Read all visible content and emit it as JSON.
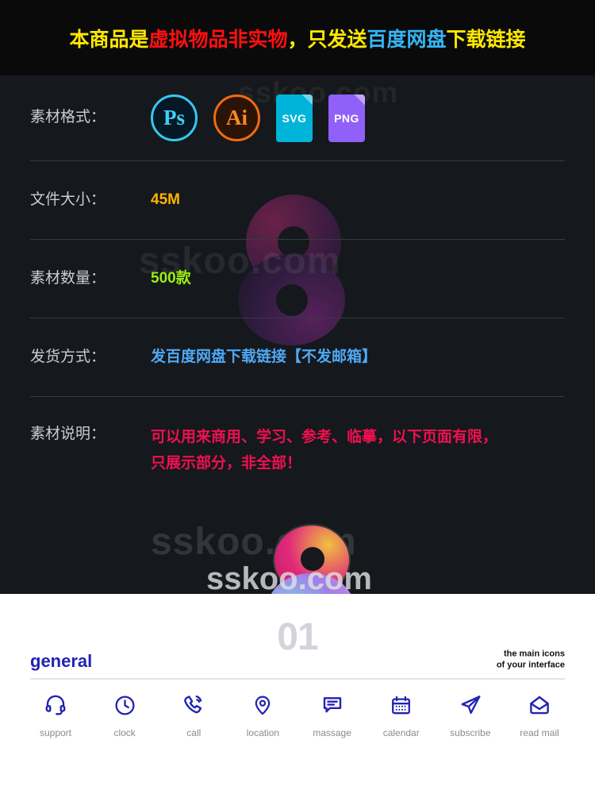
{
  "banner": {
    "segments": [
      {
        "text": "本商品是",
        "color": "#FFE800"
      },
      {
        "text": "虚拟物品非实物",
        "color": "#FF1010"
      },
      {
        "text": "，只发送",
        "color": "#FFE800"
      },
      {
        "text": "百度网盘",
        "color": "#35B5F5"
      },
      {
        "text": "下载链接",
        "color": "#FFE800"
      }
    ],
    "full_text": "本商品是虚拟物品非实物，只发送百度网盘下载链接"
  },
  "watermarks": {
    "top": "sskoo.com",
    "middle": "sskoo.com",
    "lower": "sskoo.com",
    "bottom": "sskoo.com"
  },
  "info": {
    "format": {
      "label": "素材格式：",
      "icons": [
        {
          "name": "photoshop-icon",
          "text": "Ps",
          "color": "#3FD2F5"
        },
        {
          "name": "illustrator-icon",
          "text": "Ai",
          "color": "#FF8A1E"
        },
        {
          "name": "svg-file-icon",
          "text": "SVG",
          "color": "#00B3D9"
        },
        {
          "name": "png-file-icon",
          "text": "PNG",
          "color": "#9060F8"
        }
      ]
    },
    "filesize": {
      "label": "文件大小：",
      "value": "45M",
      "color": "#FFB400"
    },
    "quantity": {
      "label": "素材数量：",
      "value": "500款",
      "color": "#9BEE10"
    },
    "delivery": {
      "label": "发货方式：",
      "value": "发百度网盘下载链接【不发邮箱】",
      "color": "#4FA8F5"
    },
    "description": {
      "label": "素材说明：",
      "value": "可以用来商用、学习、参考、临摹，以下页面有限，只展示部分，非全部！",
      "color": "#F01050"
    }
  },
  "preview": {
    "title": "general",
    "number": "01",
    "subtitle_line1": "the main icons",
    "subtitle_line2": "of your interface",
    "title_color": "#2222B4",
    "number_color": "#D2D4DA",
    "icon_color": "#2222B4",
    "icons": [
      {
        "name": "support-headset-icon",
        "label": "support"
      },
      {
        "name": "clock-icon",
        "label": "clock"
      },
      {
        "name": "call-phone-icon",
        "label": "call"
      },
      {
        "name": "location-pin-icon",
        "label": "location"
      },
      {
        "name": "massage-chat-icon",
        "label": "massage"
      },
      {
        "name": "calendar-icon",
        "label": "calendar"
      },
      {
        "name": "subscribe-paper-plane-icon",
        "label": "subscribe"
      },
      {
        "name": "read-mail-envelope-icon",
        "label": "read mail"
      }
    ]
  }
}
